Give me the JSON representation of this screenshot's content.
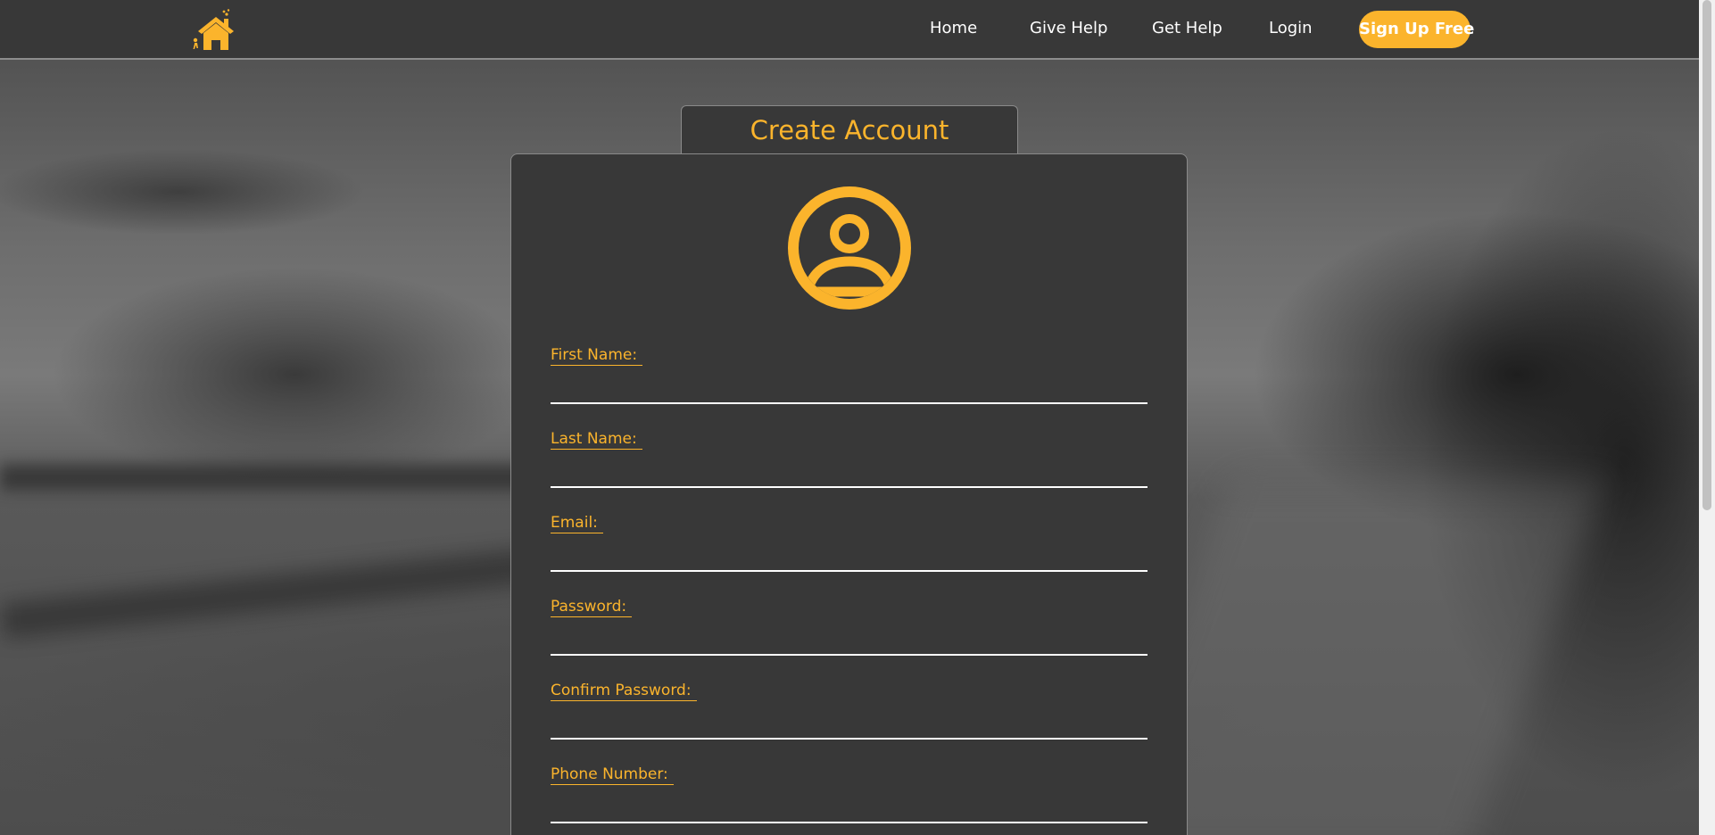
{
  "nav": {
    "links": [
      "Home",
      "Give Help",
      "Get Help",
      "Login"
    ],
    "signup_label": "Sign Up Free",
    "logo_icon": "house-logo-icon"
  },
  "form": {
    "title": "Create Account",
    "avatar_icon": "user-circle-icon",
    "fields": [
      {
        "label": "First Name:",
        "value": ""
      },
      {
        "label": "Last Name:",
        "value": ""
      },
      {
        "label": "Email:",
        "value": ""
      },
      {
        "label": "Password:",
        "value": ""
      },
      {
        "label": "Confirm Password:",
        "value": ""
      },
      {
        "label": "Phone Number:",
        "value": ""
      }
    ]
  },
  "colors": {
    "accent": "#fbb42c",
    "navbar": "#383838",
    "card": "#383838",
    "text": "#ffffff"
  }
}
